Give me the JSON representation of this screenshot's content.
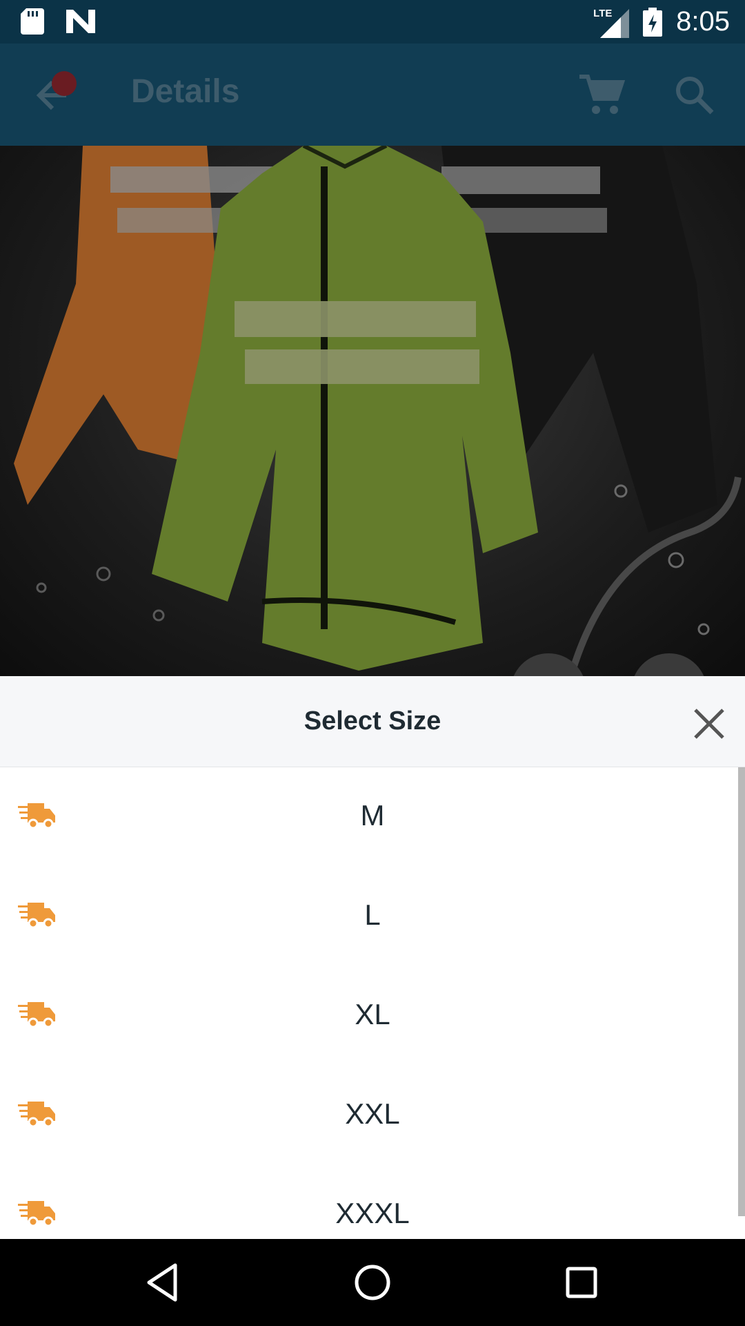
{
  "status_bar": {
    "time": "8:05",
    "network": "LTE",
    "icons": [
      "sd-card-icon",
      "n-logo-icon",
      "signal-icon",
      "battery-charging-icon"
    ]
  },
  "app_bar": {
    "title": "Details",
    "icons": [
      "back-arrow-icon",
      "cart-icon",
      "search-icon"
    ],
    "background": "#113d53"
  },
  "sheet": {
    "title": "Select Size",
    "close_icon": "close-icon",
    "sizes": [
      {
        "label": "M",
        "icon": "fast-delivery-truck-icon"
      },
      {
        "label": "L",
        "icon": "fast-delivery-truck-icon"
      },
      {
        "label": "XL",
        "icon": "fast-delivery-truck-icon"
      },
      {
        "label": "XXL",
        "icon": "fast-delivery-truck-icon"
      },
      {
        "label": "XXXL",
        "icon": "fast-delivery-truck-icon"
      }
    ],
    "accent": "#ef9a3a"
  },
  "nav_bar": {
    "icons": [
      "back-triangle-icon",
      "home-circle-icon",
      "recents-square-icon"
    ]
  }
}
